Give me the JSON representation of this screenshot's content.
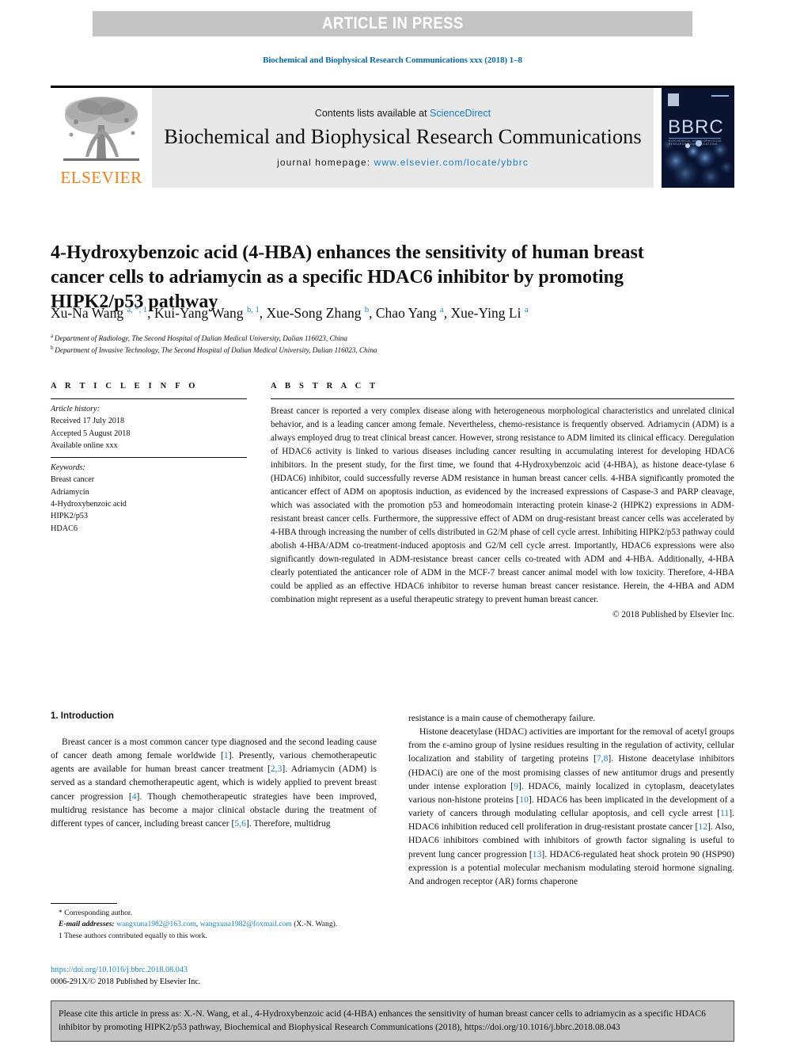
{
  "banner": {
    "text": "ARTICLE IN PRESS"
  },
  "running_head": "Biochemical and Biophysical Research Communications xxx (2018) 1–8",
  "masthead": {
    "contents_prefix": "Contents lists available at ",
    "sciencedirect": "ScienceDirect",
    "journal_name": "Biochemical and Biophysical Research Communications",
    "homepage_label": "journal homepage: ",
    "homepage_url": "www.elsevier.com/locate/ybbrc",
    "elsevier_wordmark": "ELSEVIER",
    "cover_title": "BBRC",
    "cover_subtitle": "BIOCHEMICAL AND BIOPHYSICAL RESEARCH COMMUNICATIONS"
  },
  "article": {
    "title": "4-Hydroxybenzoic acid (4-HBA) enhances the sensitivity of human breast cancer cells to adriamycin as a specific HDAC6 inhibitor by promoting HIPK2/p53 pathway",
    "authors": [
      {
        "name": "Xu-Na Wang",
        "sup": "a, *, 1",
        "sep": ", "
      },
      {
        "name": "Kui-Yang Wang",
        "sup": "b, 1",
        "sep": ", "
      },
      {
        "name": "Xue-Song Zhang",
        "sup": "b",
        "sep": ", "
      },
      {
        "name": "Chao Yang",
        "sup": "a",
        "sep": ", "
      },
      {
        "name": "Xue-Ying Li",
        "sup": "a",
        "sep": ""
      }
    ],
    "affiliations": [
      {
        "marker": "a",
        "text": "Department of Radiology, The Second Hospital of Dalian Medical University, Dalian 116023, China"
      },
      {
        "marker": "b",
        "text": "Department of Invasive Technology, The Second Hospital of Dalian Medical University, Dalian 116023, China"
      }
    ]
  },
  "article_info": {
    "heading": "A R T I C L E  I N F O",
    "history_label": "Article history:",
    "history": [
      "Received 17 July 2018",
      "Accepted 5 August 2018",
      "Available online xxx"
    ],
    "keywords_label": "Keywords:",
    "keywords": [
      "Breast cancer",
      "Adriamycin",
      "4-Hydroxybenzoic acid",
      "HIPK2/p53",
      "HDAC6"
    ]
  },
  "abstract": {
    "heading": "A B S T R A C T",
    "text": "Breast cancer is reported a very complex disease along with heterogeneous morphological characteristics and unrelated clinical behavior, and is a leading cancer among female. Nevertheless, chemo-resistance is frequently observed. Adriamycin (ADM) is a always employed drug to treat clinical breast cancer. However, strong resistance to ADM limited its clinical efficacy. Deregulation of HDAC6 activity is linked to various diseases including cancer resulting in accumulating interest for developing HDAC6 inhibitors. In the present study, for the first time, we found that 4-Hydroxybenzoic acid (4-HBA), as histone deace-tylase 6 (HDAC6) inhibitor, could successfully reverse ADM resistance in human breast cancer cells. 4-HBA significantly promoted the anticancer effect of ADM on apoptosis induction, as evidenced by the increased expressions of Caspase-3 and PARP cleavage, which was associated with the promotion p53 and homeodomain interacting protein kinase-2 (HIPK2) expressions in ADM-resistant breast cancer cells. Furthermore, the suppressive effect of ADM on drug-resistant breast cancer cells was accelerated by 4-HBA through increasing the number of cells distributed in G2/M phase of cell cycle arrest. Inhibiting HIPK2/p53 pathway could abolish 4-HBA/ADM co-treatment-induced apoptosis and G2/M cell cycle arrest. Importantly, HDAC6 expressions were also significantly down-regulated in ADM-resistance breast cancer cells co-treated with ADM and 4-HBA. Additionally, 4-HBA clearly potentiated the anticancer role of ADM in the MCF-7 breast cancer animal model with low toxicity. Therefore, 4-HBA could be applied as an effective HDAC6 inhibitor to reverse human breast cancer resistance. Herein, the 4-HBA and ADM combination might represent as a useful therapeutic strategy to prevent human breast cancer.",
    "copyright": "© 2018 Published by Elsevier Inc."
  },
  "introduction": {
    "heading": "1. Introduction",
    "left_para_1": "Breast cancer is a most common cancer type diagnosed and the second leading cause of cancer death among female worldwide [1]. Presently, various chemotherapeutic agents are available for human breast cancer treatment [2,3]. Adriamycin (ADM) is served as a standard chemotherapeutic agent, which is widely applied to prevent breast cancer progression [4]. Though chemotherapeutic strategies have been improved, multidrug resistance has become a major clinical obstacle during the treatment of different types of cancer, including breast cancer [5,6]. Therefore, multidrug",
    "right_para_0": "resistance is a main cause of chemotherapy failure.",
    "right_para_1": "Histone deacetylase (HDAC) activities are important for the removal of acetyl groups from the ε-amino group of lysine residues resulting in the regulation of activity, cellular localization and stability of targeting proteins [7,8]. Histone deacetylase inhibitors (HDACi) are one of the most promising classes of new antitumor drugs and presently under intense exploration [9]. HDAC6, mainly localized in cytoplasm, deacetylates various non-histone proteins [10]. HDAC6 has been implicated in the development of a variety of cancers through modulating cellular apoptosis, and cell cycle arrest [11]. HDAC6 inhibition reduced cell proliferation in drug-resistant prostate cancer [12]. Also, HDAC6 inhibitors combined with inhibitors of growth factor signaling is useful to prevent lung cancer progression [13]. HDAC6-regulated heat shock protein 90 (HSP90) expression is a potential molecular mechanism modulating steroid hormone signaling. And androgen receptor (AR) forms chaperone"
  },
  "footnotes": {
    "corresponding": "* Corresponding author.",
    "email_label": "E-mail addresses:",
    "email_1": "wangxuna1982@163.com",
    "email_sep": ", ",
    "email_2": "wangxuna1982@foxmail.com",
    "email_owner": "(X.-N. Wang).",
    "equal_contrib": "1  These authors contributed equally to this work.",
    "doi_url": "https://doi.org/10.1016/j.bbrc.2018.08.043",
    "issn_line": "0006-291X/© 2018 Published by Elsevier Inc."
  },
  "cite_box": {
    "text": "Please cite this article in press as: X.-N. Wang, et al., 4-Hydroxybenzoic acid (4-HBA) enhances the sensitivity of human breast cancer cells to adriamycin as a specific HDAC6 inhibitor by promoting HIPK2/p53 pathway, Biochemical and Biophysical Research Communications (2018), https://doi.org/10.1016/j.bbrc.2018.08.043"
  },
  "colors": {
    "link": "#1c7fc4",
    "banner_bg": "#c4c4c4",
    "elsevier_orange": "#ef7f1a",
    "cover_bg": "#0a1430"
  }
}
